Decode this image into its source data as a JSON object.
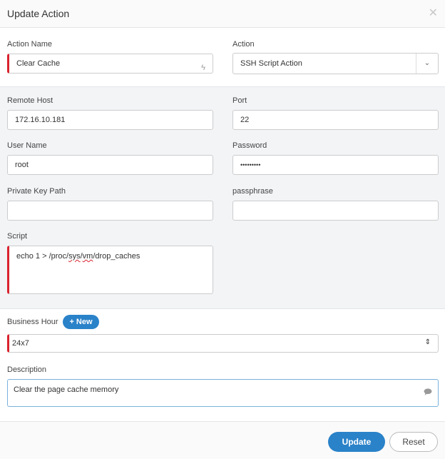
{
  "dialog": {
    "title": "Update Action",
    "close_icon": "close-icon"
  },
  "form": {
    "action_name_label": "Action Name",
    "action_name_value": "Clear Cache",
    "action_label": "Action",
    "action_value": "SSH Script Action",
    "remote_host_label": "Remote Host",
    "remote_host_value": "172.16.10.181",
    "port_label": "Port",
    "port_value": "22",
    "user_name_label": "User Name",
    "user_name_value": "root",
    "password_label": "Password",
    "password_value": "•••••••••",
    "private_key_label": "Private Key Path",
    "private_key_value": "",
    "passphrase_label": "passphrase",
    "passphrase_value": "",
    "script_label": "Script",
    "script_parts": {
      "p1": "echo 1 > /proc/",
      "p2": "sys",
      "p3": "/",
      "p4": "vm",
      "p5": "/drop_caches"
    },
    "business_hour_label": "Business Hour",
    "new_button_label": "+ New",
    "business_hour_value": "24x7",
    "description_label": "Description",
    "description_value": "Clear the page cache memory"
  },
  "footer": {
    "update_label": "Update",
    "reset_label": "Reset"
  },
  "colors": {
    "accent": "#2a82c9",
    "required": "#d9232e"
  }
}
